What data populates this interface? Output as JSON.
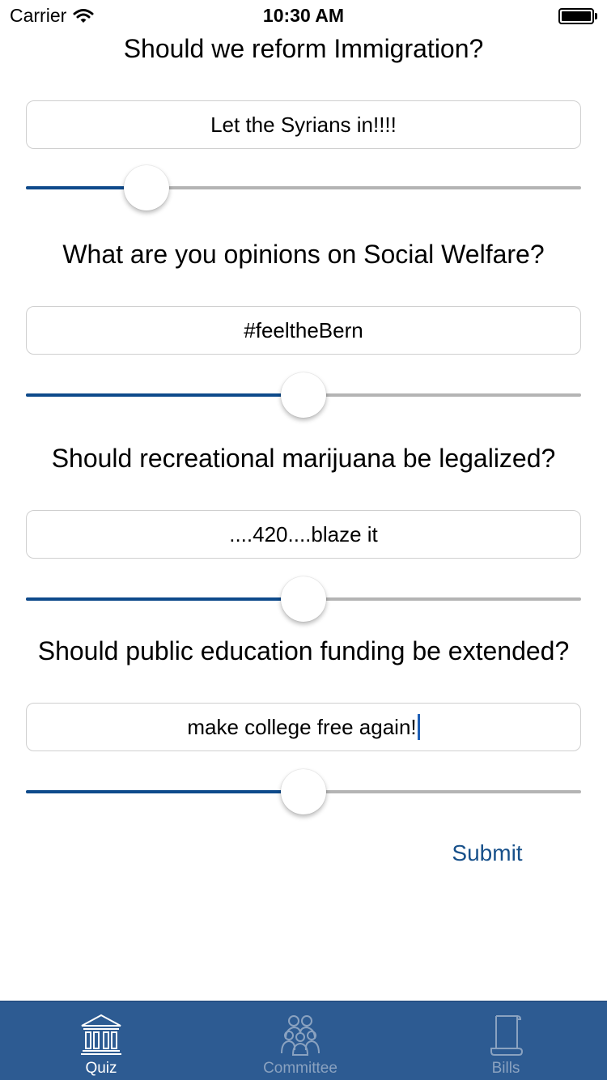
{
  "status_bar": {
    "carrier": "Carrier",
    "time": "10:30 AM"
  },
  "quiz": {
    "questions": [
      {
        "question": "Should we reform Immigration?",
        "answer": "Let the Syrians in!!!!",
        "slider_value": 0.217
      },
      {
        "question": "What are you opinions on Social Welfare?",
        "answer": "#feeltheBern",
        "slider_value": 0.5
      },
      {
        "question": "Should recreational marijuana be legalized?",
        "answer": "....420....blaze it",
        "slider_value": 0.5
      },
      {
        "question": "Should public education funding be extended?",
        "answer": "make college free again!",
        "slider_value": 0.5
      }
    ],
    "submit_label": "Submit"
  },
  "tab_bar": {
    "tabs": [
      {
        "label": "Quiz",
        "icon": "courthouse-icon",
        "active": true
      },
      {
        "label": "Committee",
        "icon": "people-group-icon",
        "active": false
      },
      {
        "label": "Bills",
        "icon": "scroll-icon",
        "active": false
      }
    ]
  },
  "colors": {
    "accent": "#0e4a8b",
    "tab_bar": "#2d5b92",
    "submit_text": "#17508a",
    "track": "#b4b4b4"
  }
}
